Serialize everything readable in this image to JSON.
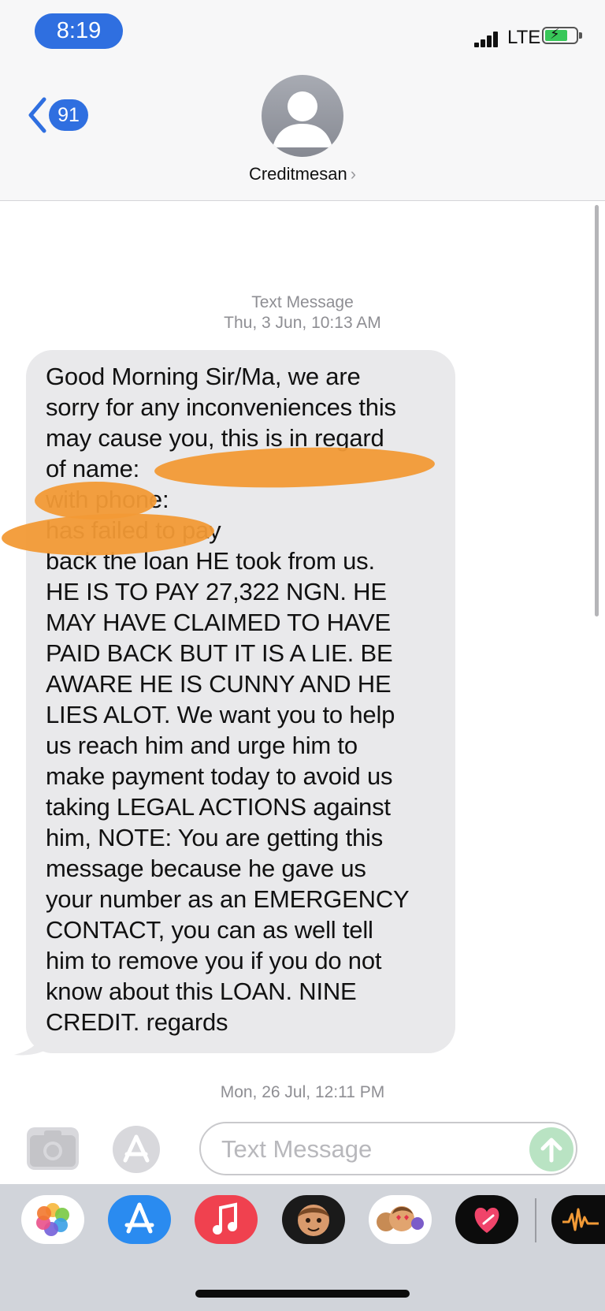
{
  "status_bar": {
    "time": "8:19",
    "network": "LTE"
  },
  "nav": {
    "back_count": "91",
    "contact_name": "Creditmesan",
    "contact_chevron": "›"
  },
  "thread": {
    "first_header_label": "Text Message",
    "first_header_day": "Thu, 3 Jun,",
    "first_header_time": "10:13 AM",
    "message": "Good Morning Sir/Ma, we are\nsorry for any inconveniences this\nmay cause you, this is in regard\nof  name:\n       with phone:\n                      has failed to pay\nback the loan HE took from  us.\nHE IS TO PAY 27,322 NGN. HE\nMAY HAVE CLAIMED TO HAVE\nPAID BACK BUT IT IS A LIE. BE\nAWARE HE IS CUNNY AND HE\nLIES ALOT. We want you to help\nus reach him and urge him to\nmake payment today to avoid us\ntaking LEGAL ACTIONS against\nhim, NOTE: You are getting this\nmessage because he gave us\nyour number as an EMERGENCY\nCONTACT, you can as well tell\nhim to remove you if you do not\nknow about this LOAN. NINE\nCREDIT. regards",
    "second_header_day": "Mon, 26 Jul,",
    "second_header_time": "12:11 PM"
  },
  "composer": {
    "placeholder": "Text Message"
  },
  "icons": {
    "back": "chevron-left-icon",
    "camera": "camera-icon",
    "apps": "app-store-icon",
    "send": "arrow-up-icon"
  },
  "dock_apps": [
    "Photos",
    "App Store",
    "Music",
    "Memoji",
    "Animoji",
    "Digital Touch",
    "Audiomack"
  ],
  "colors": {
    "ios_blue": "#2f6fe0",
    "bubble_gray": "#e9e9eb",
    "timestamp_gray": "#8e8e93",
    "redaction_orange": "#f29a36",
    "send_green": "#b9e3c3"
  }
}
